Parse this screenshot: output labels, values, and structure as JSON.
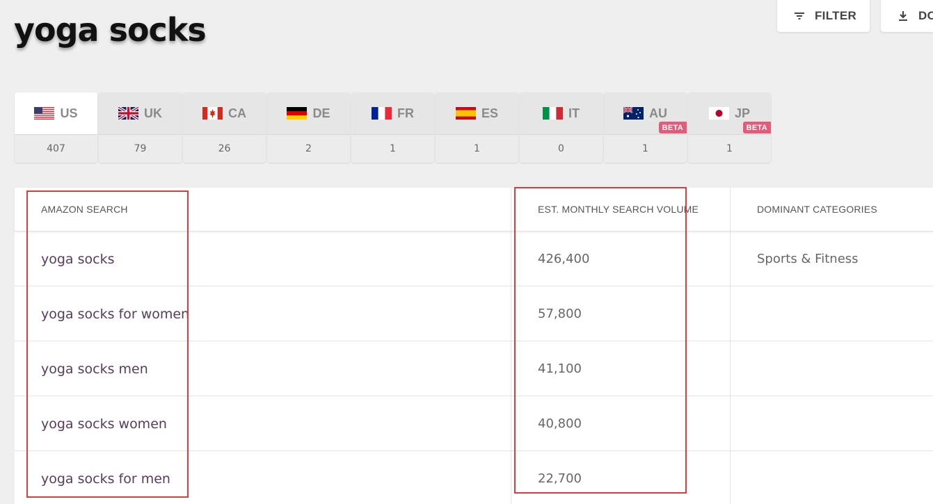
{
  "page": {
    "title": "yoga socks"
  },
  "toolbar": {
    "filter_label": "FILTER",
    "filter_icon": "filter-icon",
    "download_label": "DO",
    "download_icon": "download-icon"
  },
  "markets": [
    {
      "code": "US",
      "count": "407",
      "active": true,
      "beta": ""
    },
    {
      "code": "UK",
      "count": "79",
      "active": false,
      "beta": ""
    },
    {
      "code": "CA",
      "count": "26",
      "active": false,
      "beta": ""
    },
    {
      "code": "DE",
      "count": "2",
      "active": false,
      "beta": ""
    },
    {
      "code": "FR",
      "count": "1",
      "active": false,
      "beta": ""
    },
    {
      "code": "ES",
      "count": "1",
      "active": false,
      "beta": ""
    },
    {
      "code": "IT",
      "count": "0",
      "active": false,
      "beta": ""
    },
    {
      "code": "AU",
      "count": "1",
      "active": false,
      "beta": "BETA"
    },
    {
      "code": "JP",
      "count": "1",
      "active": false,
      "beta": "BETA"
    }
  ],
  "table": {
    "headers": {
      "search": "AMAZON SEARCH",
      "volume": "EST. MONTHLY SEARCH VOLUME",
      "categories": "DOMINANT CATEGORIES"
    },
    "rows": [
      {
        "search": "yoga socks",
        "volume": "426,400",
        "category": "Sports & Fitness"
      },
      {
        "search": "yoga socks for women",
        "volume": "57,800",
        "category": ""
      },
      {
        "search": "yoga socks men",
        "volume": "41,100",
        "category": ""
      },
      {
        "search": "yoga socks women",
        "volume": "40,800",
        "category": ""
      },
      {
        "search": "yoga socks for men",
        "volume": "22,700",
        "category": ""
      }
    ]
  },
  "colors": {
    "highlight": "#e03c3c",
    "beta_badge": "#e55a79",
    "search_link": "#5a3a5e"
  }
}
